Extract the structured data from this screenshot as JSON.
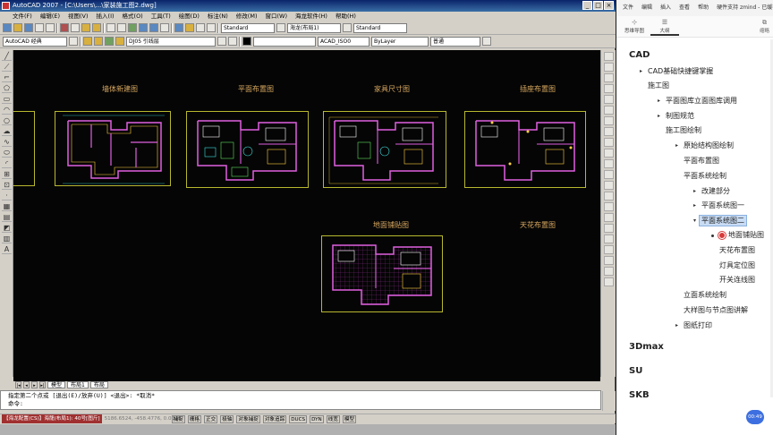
{
  "cad": {
    "title": "AutoCAD 2007 - [C:\\Users\\...\\家装施工图2.dwg]",
    "menu": [
      "文件(F)",
      "编辑(E)",
      "视图(V)",
      "插入(I)",
      "格式(O)",
      "工具(T)",
      "绘图(D)",
      "标注(N)",
      "修改(M)",
      "窗口(W)",
      "海龙软件(H)",
      "帮助(H)"
    ],
    "toolbar": {
      "workspace": "AutoCAD 经典",
      "layer": "DJ05 引线层",
      "text_style": "Standard",
      "dim_style": "海龙(布局1)",
      "table_style": "Standard",
      "linetype": "ACAD_ISO0",
      "lineweight": "ByLayer",
      "color": "普通"
    },
    "drawings": [
      {
        "title": "墙体新建图"
      },
      {
        "title": "平面布置图"
      },
      {
        "title": "家具尺寸图"
      },
      {
        "title": "插座布置图"
      },
      {
        "title": "地面铺贴图"
      },
      {
        "title": "天花布置图"
      }
    ],
    "tabs": {
      "model": "模型",
      "layout1": "布局1",
      "layout2": "布局"
    },
    "command_lines": [
      "指定第二个点或 [退出(E)/放弃(U)] <退出>: *取消*",
      "命令:"
    ],
    "status": {
      "prefix": "【海龙配置(CS)】海龍(布局1): 40号[图斤]",
      "coords": "5186.6524, -458.4776, 0.0000",
      "toggles": [
        "捕捉",
        "栅格",
        "正交",
        "极轴",
        "对象捕捉",
        "对象追踪",
        "DUCS",
        "DYN",
        "线宽",
        "模型"
      ]
    }
  },
  "panel": {
    "menu": [
      "文件",
      "编辑",
      "插入",
      "查看",
      "帮助",
      "硬件支持 zmind - 已缓存"
    ],
    "tools": {
      "left": "思维导图",
      "right": "大纲",
      "side": "缩略"
    },
    "tree": [
      {
        "id": "cad",
        "label": "CAD",
        "level": 0
      },
      {
        "id": "n1",
        "label": "CAD基础快捷键掌握",
        "level": 1,
        "caret": "▸"
      },
      {
        "id": "n2",
        "label": "施工图",
        "level": 1
      },
      {
        "id": "n3",
        "label": "平面图库立面图库调用",
        "level": 2,
        "caret": "▸"
      },
      {
        "id": "n4",
        "label": "制图规范",
        "level": 2,
        "caret": "▸"
      },
      {
        "id": "n5",
        "label": "施工图绘制",
        "level": 2
      },
      {
        "id": "n6",
        "label": "原始结构图绘制",
        "level": 3,
        "caret": "▸"
      },
      {
        "id": "n7",
        "label": "平面布置图",
        "level": 3
      },
      {
        "id": "n8",
        "label": "平面系统绘制",
        "level": 3
      },
      {
        "id": "n9",
        "label": "改建部分",
        "level": 4,
        "caret": "▸"
      },
      {
        "id": "n10",
        "label": "平面系统图一",
        "level": 4,
        "caret": "▸"
      },
      {
        "id": "n11",
        "label": "平面系统图二",
        "level": 4,
        "caret": "▾",
        "selected": true
      },
      {
        "id": "n12",
        "label": "地面铺贴图",
        "level": 5,
        "marker": true
      },
      {
        "id": "n13",
        "label": "天花布置图",
        "level": 5
      },
      {
        "id": "n14",
        "label": "灯具定位图",
        "level": 5
      },
      {
        "id": "n15",
        "label": "开关连线图",
        "level": 5
      },
      {
        "id": "n16",
        "label": "立面系统绘制",
        "level": 3
      },
      {
        "id": "n17",
        "label": "大样图与节点图讲解",
        "level": 3
      },
      {
        "id": "n18",
        "label": "图纸打印",
        "level": 3,
        "caret": "▸"
      },
      {
        "id": "max",
        "label": "3Dmax",
        "level": 0
      },
      {
        "id": "su",
        "label": "SU",
        "level": 0
      },
      {
        "id": "skb",
        "label": "SKB",
        "level": 0
      }
    ],
    "badge": "00:49"
  }
}
